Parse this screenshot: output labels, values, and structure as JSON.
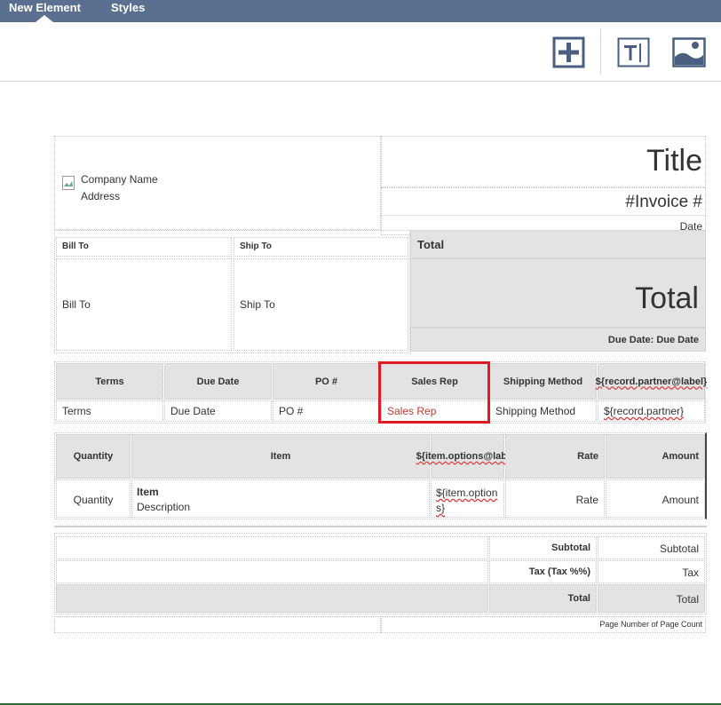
{
  "tabs": [
    {
      "label": "New Element"
    },
    {
      "label": "Styles"
    }
  ],
  "toolbar": {
    "icons": [
      "add-element-icon",
      "text-element-icon",
      "image-element-icon"
    ]
  },
  "header": {
    "company_name": "Company Name",
    "address": "Address",
    "title": "Title",
    "invoice_num": "#Invoice #",
    "date": "Date"
  },
  "address": {
    "bill_to_header": "Bill To",
    "ship_to_header": "Ship To",
    "bill_to_value": "Bill To",
    "ship_to_value": "Ship To"
  },
  "totals_box": {
    "header": "Total",
    "amount": "Total",
    "due_date": "Due Date: Due Date"
  },
  "info_table": {
    "headers": [
      "Terms",
      "Due Date",
      "PO #",
      "Sales Rep",
      "Shipping Method",
      "${record.partner@label}"
    ],
    "values": [
      "Terms",
      "Due Date",
      "PO #",
      "Sales Rep",
      "Shipping Method",
      "${record.partner}"
    ]
  },
  "items_table": {
    "headers": [
      "Quantity",
      "Item",
      "${item.options@label}",
      "Rate",
      "Amount"
    ],
    "row": {
      "quantity": "Quantity",
      "item": "Item",
      "description": "Description",
      "options": "${item.options}",
      "rate": "Rate",
      "amount": "Amount"
    }
  },
  "summary": {
    "subtotal_label": "Subtotal",
    "subtotal_value": "Subtotal",
    "tax_label": "Tax (Tax %%)",
    "tax_value": "Tax",
    "total_label": "Total",
    "total_value": "Total"
  },
  "footer": {
    "page_number": "Page Number of Page Count"
  },
  "colors": {
    "topbar": "#5b6f90",
    "icon": "#4a5f80",
    "highlight": "#e01b24",
    "sales_rep_text": "#c0392b",
    "cell_grey": "#e3e3e3"
  }
}
